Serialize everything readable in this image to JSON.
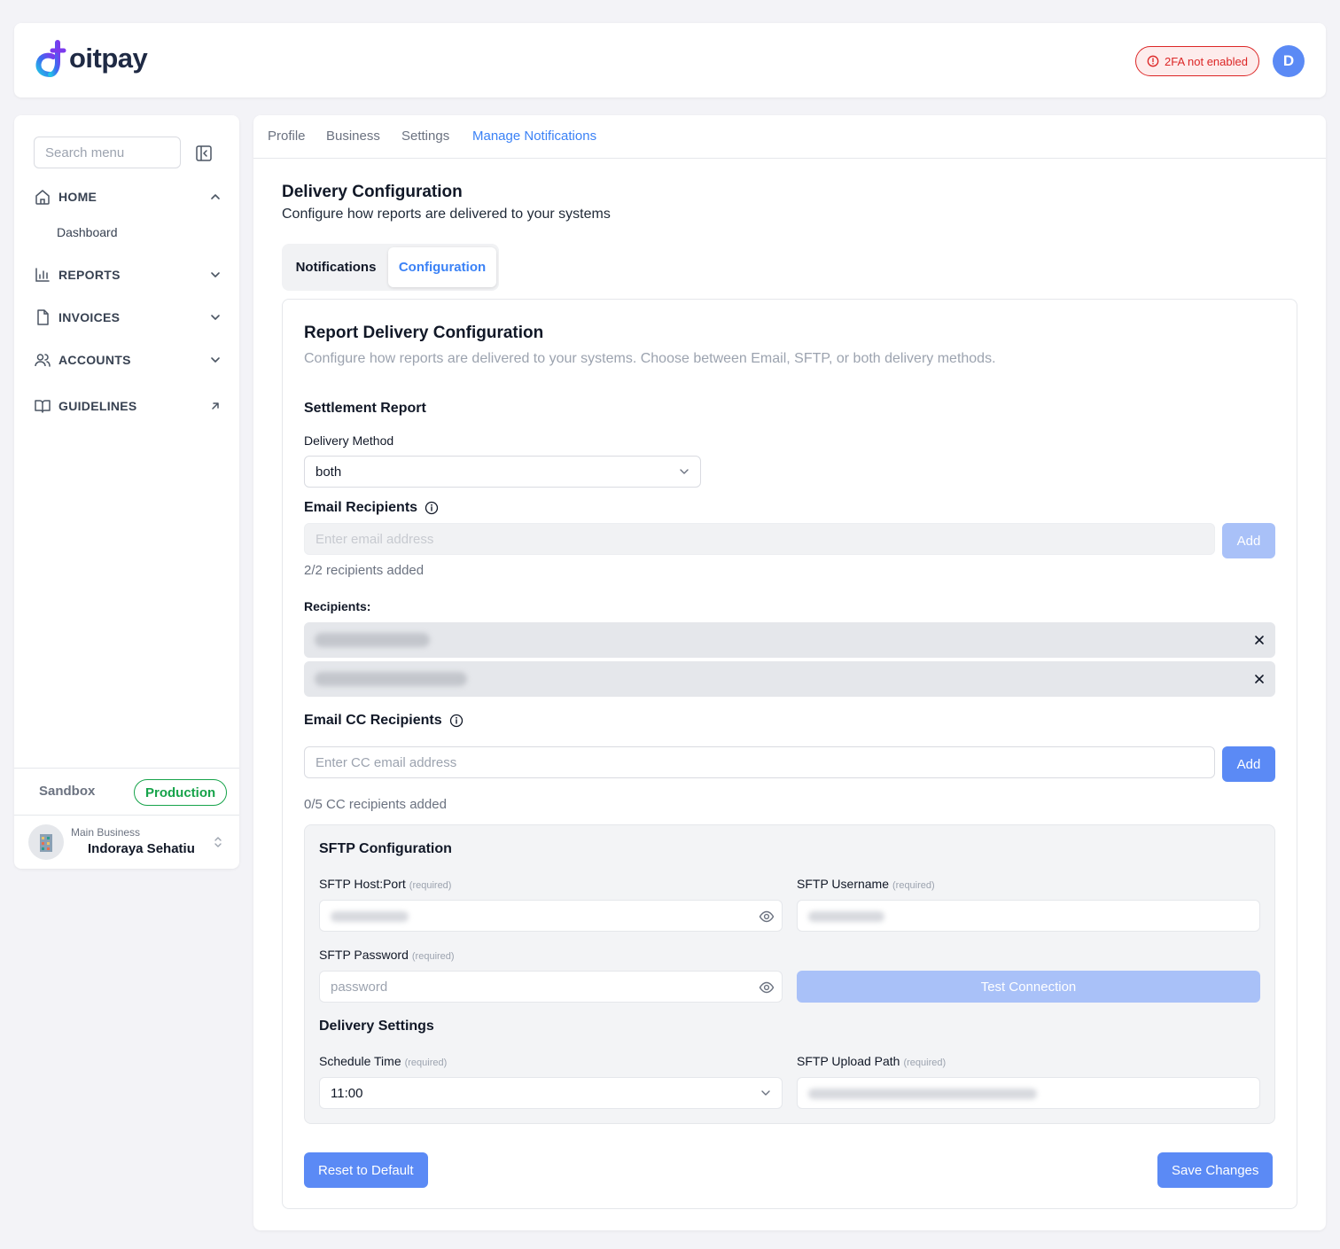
{
  "brand": {
    "logo_text": "oitpay"
  },
  "header": {
    "twofa_label": "2FA not enabled",
    "avatar_initial": "D"
  },
  "sidebar": {
    "search_placeholder": "Search menu",
    "items": [
      {
        "label": "HOME",
        "icon": "home-icon",
        "chevron": "chevron-up-icon"
      },
      {
        "label": "REPORTS",
        "icon": "bar-chart-icon",
        "chevron": "chevron-down-icon"
      },
      {
        "label": "INVOICES",
        "icon": "file-icon",
        "chevron": "chevron-down-icon"
      },
      {
        "label": "ACCOUNTS",
        "icon": "users-icon",
        "chevron": "chevron-down-icon"
      },
      {
        "label": "GUIDELINES",
        "icon": "book-icon",
        "chevron": "external-arrow-icon"
      }
    ],
    "home_sub": "Dashboard",
    "env": {
      "sandbox": "Sandbox",
      "production": "Production"
    },
    "business": {
      "caption": "Main Business",
      "name": "Indoraya Sehatiu"
    }
  },
  "tabs": [
    "Profile",
    "Business",
    "Settings",
    "Manage Notifications"
  ],
  "page": {
    "title": "Delivery Configuration",
    "subtitle": "Configure how reports are delivered to your systems"
  },
  "segment": {
    "notifications": "Notifications",
    "configuration": "Configuration"
  },
  "card": {
    "title": "Report Delivery Configuration",
    "description": "Configure how reports are delivered to your systems. Choose between Email, SFTP, or both delivery methods.",
    "section": "Settlement Report",
    "delivery_method_label": "Delivery Method",
    "delivery_method_value": "both",
    "email_recipients_label": "Email Recipients",
    "email_placeholder": "Enter email address",
    "add_label": "Add",
    "recipients_count": "2/2 recipients added",
    "recipients_label": "Recipients:",
    "cc_label": "Email CC Recipients",
    "cc_placeholder": "Enter CC email address",
    "cc_count": "0/5 CC recipients added"
  },
  "sftp": {
    "title": "SFTP Configuration",
    "host_label": "SFTP Host:Port",
    "username_label": "SFTP Username",
    "password_label": "SFTP Password",
    "password_placeholder": "password",
    "required": "(required)",
    "test_label": "Test Connection",
    "delivery_settings": "Delivery Settings",
    "schedule_label": "Schedule Time",
    "schedule_value": "11:00",
    "upload_path_label": "SFTP Upload Path"
  },
  "actions": {
    "reset": "Reset to Default",
    "save": "Save Changes"
  },
  "colors": {
    "accent": "#5b8af5",
    "active_tab": "#3b82f6",
    "danger": "#dc2626",
    "success": "#16a34a"
  }
}
